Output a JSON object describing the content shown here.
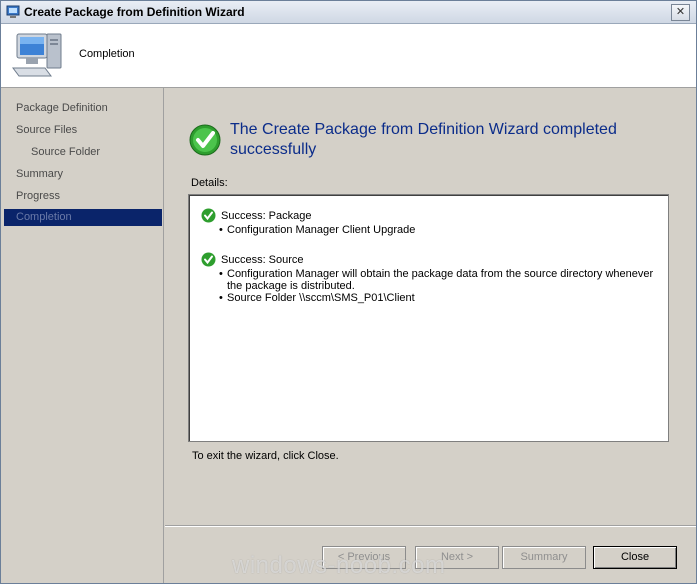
{
  "window": {
    "title": "Create Package from Definition Wizard",
    "close_glyph": "✕"
  },
  "header": {
    "title": "Completion",
    "icon": "computer-icon"
  },
  "sidebar": {
    "items": [
      {
        "label": "Package Definition"
      },
      {
        "label": "Source Files"
      },
      {
        "label": "Source Folder"
      },
      {
        "label": "Summary"
      },
      {
        "label": "Progress"
      },
      {
        "label": "Completion"
      }
    ],
    "active": "Completion"
  },
  "main": {
    "heading": "The Create Package from Definition Wizard completed successfully",
    "details_label": "Details:",
    "details": [
      {
        "status": "Success: Package",
        "bullets": [
          "Configuration Manager Client Upgrade"
        ]
      },
      {
        "status": "Success: Source",
        "bullets": [
          "Configuration Manager will obtain the package data from the source directory whenever",
          "the package is distributed.",
          "Source Folder \\\\sccm\\SMS_P01\\Client"
        ]
      }
    ],
    "exit_text": "To exit the wizard, click Close."
  },
  "buttons": {
    "previous": "< Previous",
    "next": "Next >",
    "summary": "Summary",
    "close": "Close"
  },
  "watermark": "windows-noob.com",
  "colors": {
    "accent": "#0a246a",
    "heading": "#0b2c8a",
    "success": "#2e9e2e"
  }
}
